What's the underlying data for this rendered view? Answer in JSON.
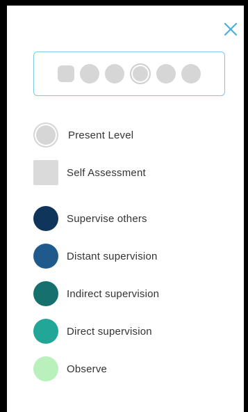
{
  "close_icon": "close-icon",
  "accent_color": "#4aaee0",
  "level_indicator": {
    "total_levels": 6,
    "self_assessment_level": 1,
    "present_level": 4
  },
  "legend": {
    "present_level": {
      "label": "Present Level",
      "color": "#d6d6d6"
    },
    "self_assessment": {
      "label": "Self Assessment",
      "color": "#dadada"
    },
    "supervision_levels": [
      {
        "label": "Supervise others",
        "color": "#10355a"
      },
      {
        "label": "Distant supervision",
        "color": "#205a8c"
      },
      {
        "label": "Indirect supervision",
        "color": "#16706e"
      },
      {
        "label": "Direct supervision",
        "color": "#21a697"
      },
      {
        "label": "Observe",
        "color": "#b9f0bc"
      }
    ]
  }
}
